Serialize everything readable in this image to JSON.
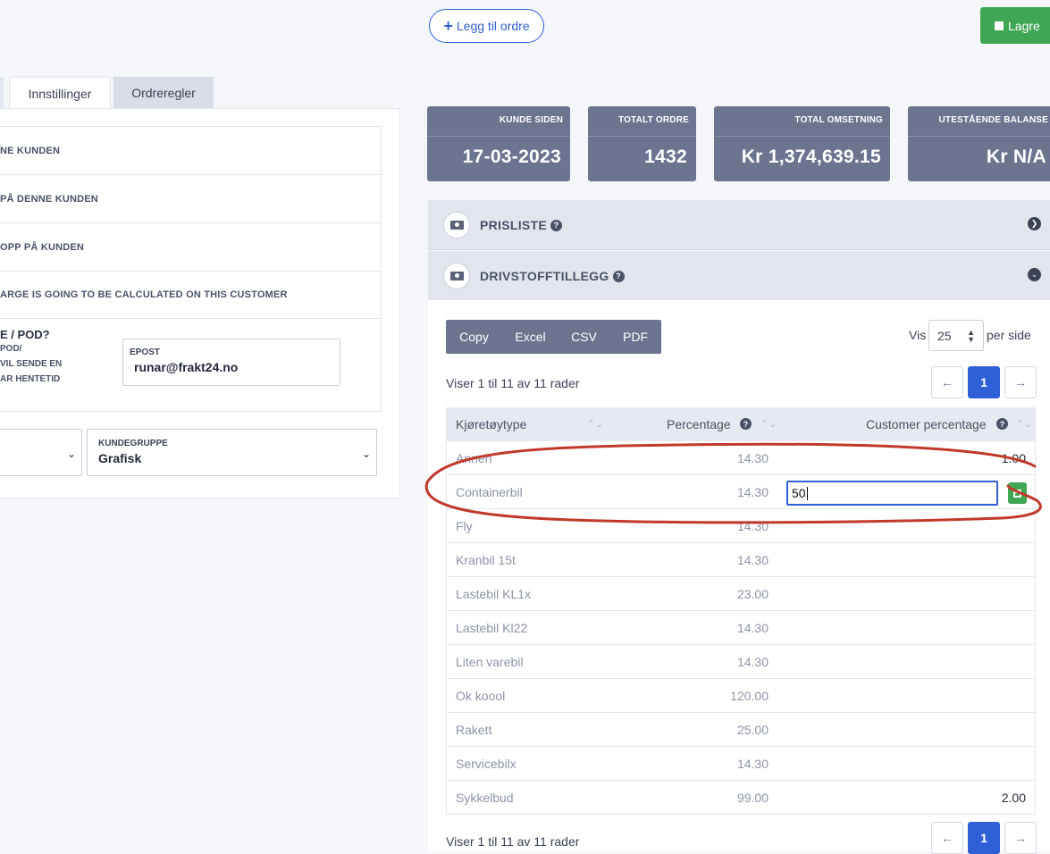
{
  "toolbar": {
    "add_order": "Legg til ordre",
    "save": "Lagre"
  },
  "tabs": {
    "active": "Innstillinger",
    "other": "Ordreregler"
  },
  "settings": {
    "rows": [
      "NE KUNDEN",
      "PÅ DENNE KUNDEN",
      "OPP PÅ KUNDEN",
      "ARGE IS GOING TO BE CALCULATED ON THIS CUSTOMER"
    ],
    "pod_title": "E / POD?",
    "pod_lines": [
      "POD/",
      "VIL SENDE EN",
      "AR HENTETID"
    ],
    "epost_label": "EPOST",
    "epost_value": "runar@frakt24.no",
    "kundegruppe_label": "KUNDEGRUPPE",
    "kundegruppe_value": "Grafisk"
  },
  "stats": [
    {
      "label": "KUNDE SIDEN",
      "value": "17-03-2023"
    },
    {
      "label": "TOTALT ORDRE",
      "value": "1432"
    },
    {
      "label": "TOTAL OMSETNING",
      "value": "Kr 1,374,639.15"
    },
    {
      "label": "UTESTÅENDE BALANSE",
      "value": "Kr N/A"
    }
  ],
  "accordion": {
    "prisliste": "PRISLISTE",
    "drivstoff": "DRIVSTOFFTILLEGG"
  },
  "export": [
    "Copy",
    "Excel",
    "CSV",
    "PDF"
  ],
  "pagesize": {
    "vis": "Vis",
    "value": "25",
    "per_side": "per side"
  },
  "info_top": "Viser 1 til 11 av 11 rader",
  "info_bottom": "Viser 1 til 11 av 11 rader",
  "pagination": {
    "prev": "←",
    "page": "1",
    "next": "→"
  },
  "table": {
    "headers": [
      "Kjøretøytype",
      "Percentage",
      "Customer percentage"
    ],
    "rows": [
      {
        "type": "Annen",
        "pct": "14.30",
        "cust": "1.00"
      },
      {
        "type": "Containerbil",
        "pct": "14.30",
        "cust": ""
      },
      {
        "type": "Fly",
        "pct": "14.30",
        "cust": ""
      },
      {
        "type": "Kranbil 15t",
        "pct": "14.30",
        "cust": ""
      },
      {
        "type": "Lastebil KL1x",
        "pct": "23.00",
        "cust": ""
      },
      {
        "type": "Lastebil Kl22",
        "pct": "14.30",
        "cust": ""
      },
      {
        "type": "Liten varebil",
        "pct": "14.30",
        "cust": ""
      },
      {
        "type": "Ok koool",
        "pct": "120.00",
        "cust": ""
      },
      {
        "type": "Rakett",
        "pct": "25.00",
        "cust": ""
      },
      {
        "type": "Servicebilx",
        "pct": "14.30",
        "cust": ""
      },
      {
        "type": "Sykkelbud",
        "pct": "99.00",
        "cust": "2.00"
      }
    ],
    "edit_value": "50"
  },
  "colors": {
    "accent": "#2f5fd6",
    "success": "#3fa653",
    "stat_bg": "#6d7490",
    "annotation": "#c0392b"
  }
}
